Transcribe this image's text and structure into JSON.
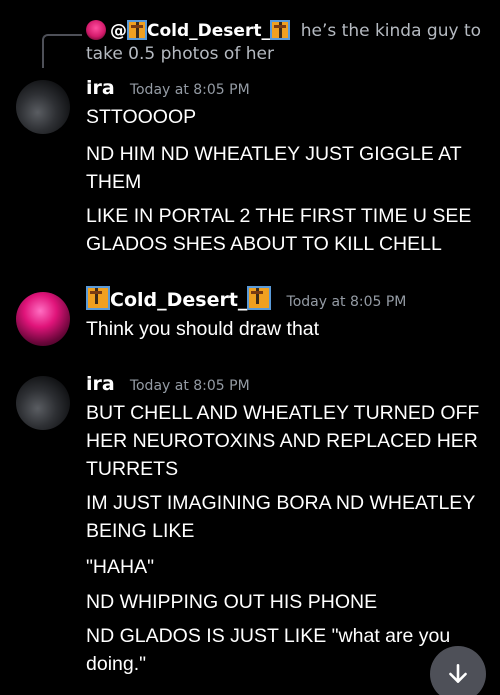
{
  "reply": {
    "mention": "@",
    "name": "Cold_Desert_",
    "text": "he’s the kinda guy to take 0.5 photos of her"
  },
  "messages": [
    {
      "author": "ira",
      "timestamp": "Today at 8:05 PM",
      "lines": [
        "STTOOOOP",
        "ND HIM ND WHEATLEY JUST GIGGLE AT THEM",
        "LIKE IN PORTAL 2 THE FIRST TIME U SEE GLADOS SHES ABOUT TO KILL CHELL"
      ]
    },
    {
      "author": "Cold_Desert_",
      "timestamp": "Today at 8:05 PM",
      "lines": [
        "Think you should draw that"
      ]
    },
    {
      "author": "ira",
      "timestamp": "Today at 8:05 PM",
      "lines": [
        "BUT CHELL AND WHEATLEY TURNED OFF HER NEUROTOXINS AND REPLACED HER TURRETS",
        "IM JUST IMAGINING BORA ND WHEATLEY BEING LIKE",
        "\"HAHA\"",
        "ND WHIPPING OUT HIS PHONE",
        "ND GLADOS IS JUST LIKE \"what are you doing.\""
      ]
    }
  ],
  "colors": {
    "background": "#000000",
    "muted": "#949ba4",
    "text": "#ffffff"
  }
}
